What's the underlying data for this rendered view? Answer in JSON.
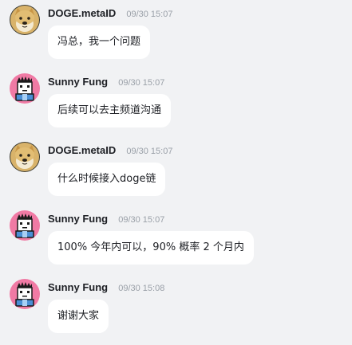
{
  "messages": [
    {
      "author": "DOGE.metaID",
      "time": "09/30 15:07",
      "text": "冯总，我一个问题",
      "avatar": "doge-avatar"
    },
    {
      "author": "Sunny Fung",
      "time": "09/30 15:07",
      "text": "后续可以去主频道沟通",
      "avatar": "pixel-character-avatar"
    },
    {
      "author": "DOGE.metaID",
      "time": "09/30 15:07",
      "text": "什么时候接入doge链",
      "avatar": "doge-avatar"
    },
    {
      "author": "Sunny Fung",
      "time": "09/30 15:07",
      "text": "100% 今年内可以，90% 概率 2 个月内",
      "avatar": "pixel-character-avatar"
    },
    {
      "author": "Sunny Fung",
      "time": "09/30 15:08",
      "text": "谢谢大家",
      "avatar": "pixel-character-avatar"
    }
  ],
  "colors": {
    "background": "#f1f2f4",
    "bubble": "#ffffff",
    "author": "#1d1f24",
    "timestamp": "#9aa0a8",
    "pixel_avatar_bg": "#f07aa4"
  }
}
